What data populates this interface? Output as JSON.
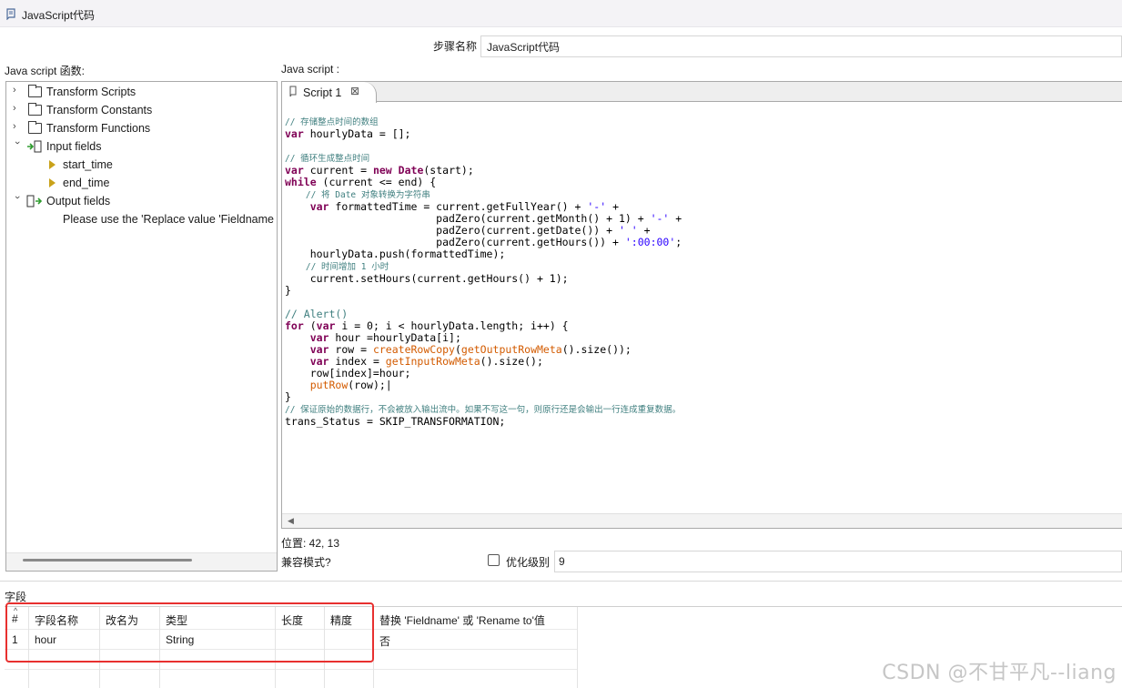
{
  "window": {
    "title": "JavaScript代码"
  },
  "step": {
    "label": "步骤名称",
    "value": "JavaScript代码"
  },
  "left_panel": {
    "title": "Java script 函数:",
    "tree": [
      {
        "label": "Transform Scripts",
        "expanded": false
      },
      {
        "label": "Transform Constants",
        "expanded": false
      },
      {
        "label": "Transform Functions",
        "expanded": false
      },
      {
        "label": "Input fields",
        "expanded": true,
        "children": [
          "start_time",
          "end_time"
        ]
      },
      {
        "label": "Output fields",
        "expanded": true,
        "children": [
          "Please use the 'Replace value 'Fieldname"
        ]
      }
    ]
  },
  "editor": {
    "title": "Java script :",
    "tab_label": "Script 1",
    "code_lines": [
      "// 存储整点时间的数组",
      "var hourlyData = [];",
      "",
      "// 循环生成整点时间",
      "var current = new Date(start);",
      "while (current <= end) {",
      "    // 将 Date 对象转换为字符串",
      "    var formattedTime = current.getFullYear() + '-' +",
      "                        padZero(current.getMonth() + 1) + '-' +",
      "                        padZero(current.getDate()) + ' ' +",
      "                        padZero(current.getHours()) + ':00:00';",
      "    hourlyData.push(formattedTime);",
      "    // 时间增加 1 小时",
      "    current.setHours(current.getHours() + 1);",
      "}",
      "",
      "// Alert()",
      "for (var i = 0; i < hourlyData.length; i++) {",
      "    var hour =hourlyData[i];",
      "    var row = createRowCopy(getOutputRowMeta().size());",
      "    var index = getInputRowMeta().size();",
      "    row[index]=hour;",
      "    putRow(row);",
      "}",
      "// 保证原始的数据行，不会被放入输出流中。如果不写这一句，则原行还是会输出一行连成重复数据。",
      "trans_Status = SKIP_TRANSFORMATION;"
    ]
  },
  "status": {
    "position": "位置: 42, 13",
    "compat_label": "兼容模式?",
    "optimize_label": "优化级别",
    "optimize_value": "9"
  },
  "fields": {
    "title": "字段",
    "columns": [
      "#",
      "字段名称",
      "改名为",
      "类型",
      "长度",
      "精度",
      "替换 'Fieldname' 或 'Rename to'值"
    ],
    "rows": [
      [
        "1",
        "hour",
        "",
        "String",
        "",
        "",
        "否"
      ]
    ]
  },
  "watermark": "CSDN @不甘平凡--liang",
  "colors": {
    "highlight": "#e8302f",
    "keyword": "#7f0055",
    "comment": "#3f7f7f",
    "string": "#2a00ff",
    "function": "#d35b00"
  }
}
